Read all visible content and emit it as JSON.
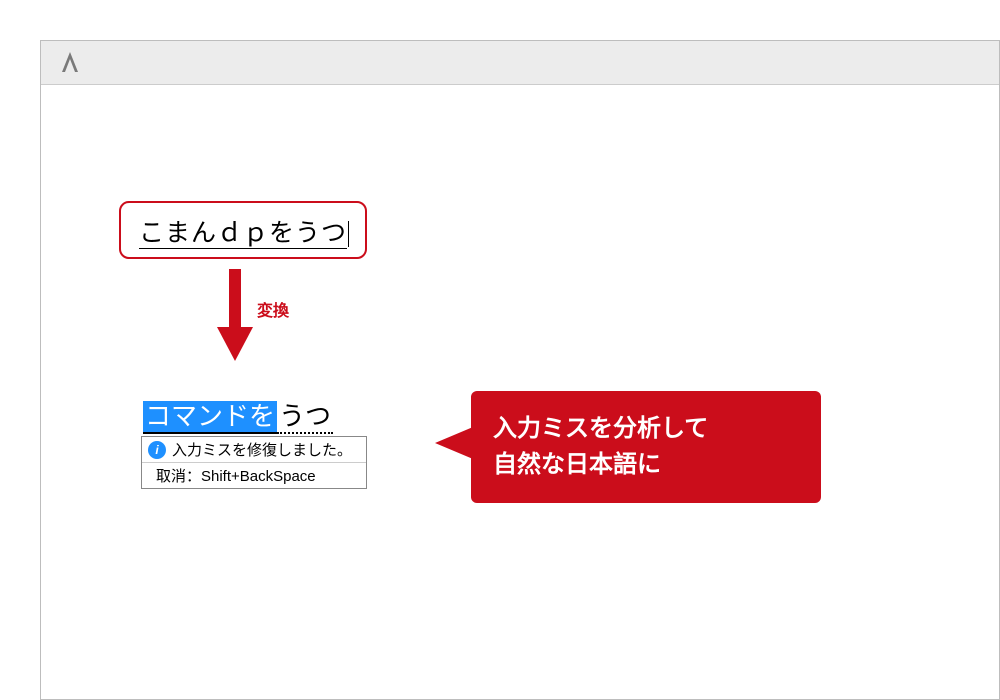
{
  "toolbar": {
    "icon_letter": "A"
  },
  "input": {
    "raw_text": "こまんｄｐをうつ"
  },
  "arrow": {
    "label": "変換"
  },
  "result": {
    "highlighted": "コマンドを",
    "rest": "うつ"
  },
  "ime": {
    "message": "入力ミスを修復しました。",
    "undo_hint": "取消：Shift+BackSpace"
  },
  "callout": {
    "line1": "入力ミスを分析して",
    "line2": "自然な日本語に"
  }
}
